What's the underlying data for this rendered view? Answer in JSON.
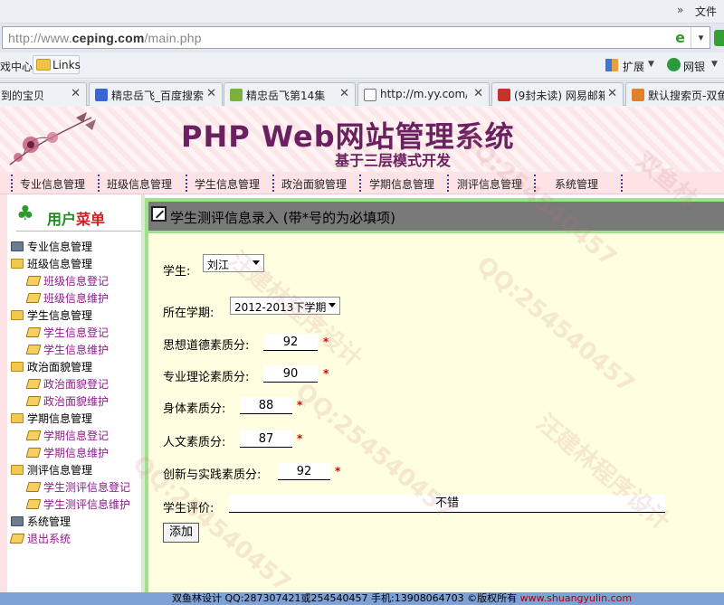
{
  "browser": {
    "menu": {
      "chevron": "»",
      "file_label": "文件"
    },
    "address": {
      "url_prefix": "http://www.",
      "url_domain": "ceping.com",
      "url_path": "/main.php",
      "dropdown_glyph": "▾"
    },
    "favorites": {
      "left_fragment": "戏中心",
      "links_label": "Links",
      "extensions_label": "扩展",
      "bank_label": "网银"
    },
    "tabs": [
      {
        "title": "到的宝贝",
        "icon_color": "#e06a2c"
      },
      {
        "title": "精忠岳飞_百度搜索",
        "icon_color": "#3b64d8"
      },
      {
        "title": "精忠岳飞第14集",
        "icon_color": "#7ab23a"
      },
      {
        "title": "http://m.yy.com/…",
        "icon_color": "#ffffff"
      },
      {
        "title": "(9封未读) 网易邮箱",
        "icon_color": "#c8302a"
      },
      {
        "title": "默认搜索页-双鱼",
        "icon_color": "#e3812b"
      }
    ],
    "tab_close_glyph": "✕"
  },
  "site": {
    "title": "PHP Web网站管理系统",
    "subtitle": "基于三层模式开发"
  },
  "nav": [
    "专业信息管理",
    "班级信息管理",
    "学生信息管理",
    "政治面貌管理",
    "学期信息管理",
    "测评信息管理",
    "系统管理"
  ],
  "sidebar": {
    "title_green": "用户",
    "title_red": "菜单",
    "items": [
      {
        "label": "专业信息管理",
        "kind": "top",
        "icon": "system-icon"
      },
      {
        "label": "班级信息管理",
        "kind": "top",
        "icon": "folder-icon"
      },
      {
        "label": "班级信息登记",
        "kind": "leaf",
        "icon": "page-icon"
      },
      {
        "label": "班级信息维护",
        "kind": "leaf",
        "icon": "page-icon"
      },
      {
        "label": "学生信息管理",
        "kind": "top",
        "icon": "folder-icon"
      },
      {
        "label": "学生信息登记",
        "kind": "leaf",
        "icon": "page-icon"
      },
      {
        "label": "学生信息维护",
        "kind": "leaf",
        "icon": "page-icon"
      },
      {
        "label": "政治面貌管理",
        "kind": "top",
        "icon": "folder-icon"
      },
      {
        "label": "政治面貌登记",
        "kind": "leaf",
        "icon": "page-icon"
      },
      {
        "label": "政治面貌维护",
        "kind": "leaf",
        "icon": "page-icon"
      },
      {
        "label": "学期信息管理",
        "kind": "top",
        "icon": "folder-icon"
      },
      {
        "label": "学期信息登记",
        "kind": "leaf",
        "icon": "page-icon"
      },
      {
        "label": "学期信息维护",
        "kind": "leaf",
        "icon": "page-icon"
      },
      {
        "label": "测评信息管理",
        "kind": "top",
        "icon": "folder-icon"
      },
      {
        "label": "学生测评信息登记",
        "kind": "leaf",
        "icon": "page-icon"
      },
      {
        "label": "学生测评信息维护",
        "kind": "leaf",
        "icon": "page-icon"
      },
      {
        "label": "系统管理",
        "kind": "top",
        "icon": "system-icon"
      },
      {
        "label": "退出系统",
        "kind": "leaf",
        "icon": "page-icon"
      }
    ]
  },
  "form": {
    "title": "学生测评信息录入 (带*号的为必填项)",
    "required_mark": "*",
    "student": {
      "label": "学生:",
      "value": "刘江"
    },
    "semester": {
      "label": "所在学期:",
      "value": "2012-2013下学期"
    },
    "moral": {
      "label": "思想道德素质分:",
      "value": "92"
    },
    "professional": {
      "label": "专业理论素质分:",
      "value": "90"
    },
    "physical": {
      "label": "身体素质分:",
      "value": "88"
    },
    "humanities": {
      "label": "人文素质分:",
      "value": "87"
    },
    "innovation": {
      "label": "创新与实践素质分:",
      "value": "92"
    },
    "evaluation": {
      "label": "学生评价:",
      "value": "不错"
    },
    "submit_label": "添加"
  },
  "footer": {
    "text": "双鱼林设计  QQ:287307421或254540457 手机:13908064703 ©版权所有 ",
    "link": "www.shuangyulin.com"
  },
  "watermark": {
    "qq": "QQ:254540457",
    "name": "汪建林程序设计",
    "brand": "双鱼林"
  }
}
